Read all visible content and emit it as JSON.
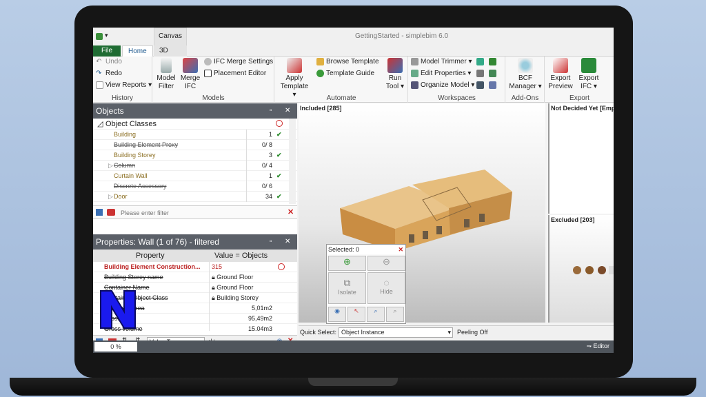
{
  "window": {
    "title": "GettingStarted - simplebim 6.0",
    "context_tab": "Canvas",
    "qat": "▾"
  },
  "tabs": {
    "file": "File",
    "home": "Home",
    "threed": "3D",
    "dot": "."
  },
  "ribbon": {
    "history": {
      "label": "History",
      "undo": "Undo",
      "redo": "Redo",
      "view_reports": "View Reports ▾"
    },
    "models": {
      "label": "Models",
      "model_filter": "Model Filter",
      "merge_ifc": "Merge IFC",
      "ifc_merge_settings": "IFC Merge Settings",
      "placement_editor": "Placement Editor"
    },
    "automate": {
      "label": "Automate",
      "apply_template": "Apply Template ▾",
      "browse_template": "Browse Template",
      "template_guide": "Template Guide",
      "run_tool": "Run Tool ▾"
    },
    "workspaces": {
      "label": "Workspaces",
      "model_trimmer": "Model Trimmer ▾",
      "edit_properties": "Edit Properties ▾",
      "organize_model": "Organize Model ▾"
    },
    "addons": {
      "label": "Add-Ons",
      "bcf_manager": "BCF Manager ▾"
    },
    "export": {
      "label": "Export",
      "export_preview": "Export Preview",
      "export_ifc": "Export IFC ▾"
    }
  },
  "objects_panel": {
    "title": "Objects",
    "root": "Object Classes",
    "rows": [
      {
        "name": "Building",
        "count": "1",
        "status": "✔",
        "struck": false
      },
      {
        "name": "Building Element Proxy",
        "count": "0/ 8",
        "status": "",
        "struck": true
      },
      {
        "name": "Building Storey",
        "count": "3",
        "status": "✔",
        "struck": false
      },
      {
        "name": "Column",
        "count": "0/ 4",
        "status": "",
        "struck": true
      },
      {
        "name": "Curtain Wall",
        "count": "1",
        "status": "✔",
        "struck": false
      },
      {
        "name": "Discrete Accessory",
        "count": "0/ 6",
        "status": "",
        "struck": true
      },
      {
        "name": "Door",
        "count": "34",
        "status": "✔",
        "struck": false
      }
    ],
    "filter_placeholder": "Please enter filter"
  },
  "properties_panel": {
    "title": "Properties: Wall (1 of 76) - filtered",
    "col_property": "Property",
    "col_value": "Value = Objects",
    "rows": [
      {
        "name": "Building Element Construction...",
        "value": "315"
      },
      {
        "name": "Building Storey name",
        "value": "Ground Floor"
      },
      {
        "name": "Container Name",
        "value": "Ground Floor"
      },
      {
        "name": "Container Object Class",
        "value": "Building Storey"
      },
      {
        "name": "Foot print area",
        "value": "5,01m2"
      },
      {
        "name": "Gross area",
        "value": "95,49m2"
      },
      {
        "name": "Gross volume",
        "value": "15,04m3"
      }
    ],
    "value_type": "Value Type",
    "search_text": ":|+"
  },
  "viewports": {
    "included": "Included [285]",
    "not_decided": "Not Decided Yet [Empty]",
    "excluded": "Excluded [203]"
  },
  "selection_panel": {
    "title": "Selected: 0",
    "isolate": "Isolate",
    "hide": "Hide"
  },
  "quick_select": {
    "label": "Quick Select:",
    "value": "Object Instance",
    "peeling": "Peeling Off"
  },
  "status": {
    "progress": "0 %",
    "editor": "Editor"
  },
  "colors": {
    "file_tab": "#1f6c33",
    "panel_header": "#5b6068",
    "check": "#2a8a2a",
    "wood": "#d9a45a"
  }
}
